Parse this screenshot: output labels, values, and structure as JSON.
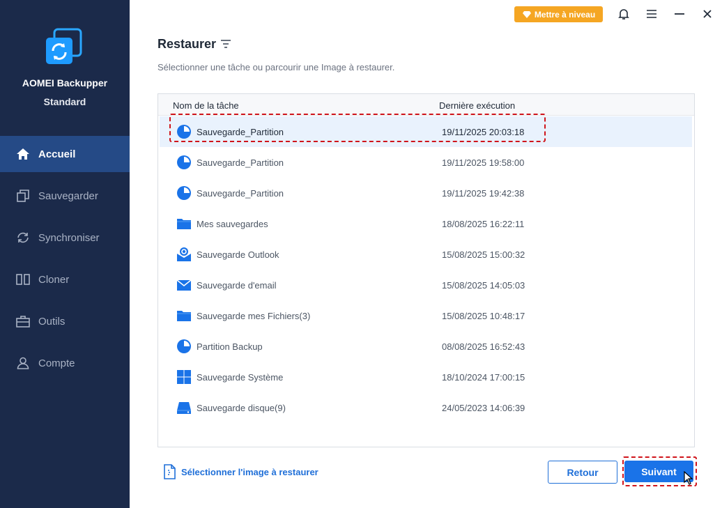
{
  "app": {
    "name": "AOMEI Backupper",
    "edition": "Standard"
  },
  "nav": [
    {
      "label": "Accueil",
      "icon": "home-icon",
      "active": true
    },
    {
      "label": "Sauvegarder",
      "icon": "copy-icon",
      "active": false
    },
    {
      "label": "Synchroniser",
      "icon": "sync-icon",
      "active": false
    },
    {
      "label": "Cloner",
      "icon": "clone-icon",
      "active": false
    },
    {
      "label": "Outils",
      "icon": "toolbox-icon",
      "active": false
    },
    {
      "label": "Compte",
      "icon": "user-icon",
      "active": false
    }
  ],
  "topbar": {
    "upgrade_label": "Mettre à niveau"
  },
  "page": {
    "title": "Restaurer",
    "subtitle": "Sélectionner une tâche ou parcourir une Image à restaurer."
  },
  "table": {
    "columns": [
      "Nom de la tâche",
      "Dernière exécution"
    ],
    "rows": [
      {
        "name": "Sauvegarde_Partition",
        "date": "19/11/2025 20:03:18",
        "icon": "partition-icon",
        "selected": true
      },
      {
        "name": "Sauvegarde_Partition",
        "date": "19/11/2025 19:58:00",
        "icon": "partition-icon"
      },
      {
        "name": "Sauvegarde_Partition",
        "date": "19/11/2025 19:42:38",
        "icon": "partition-icon"
      },
      {
        "name": "Mes sauvegardes",
        "date": "18/08/2025 16:22:11",
        "icon": "folder-icon"
      },
      {
        "name": "Sauvegarde Outlook",
        "date": "15/08/2025 15:00:32",
        "icon": "outlook-icon"
      },
      {
        "name": "Sauvegarde d'email",
        "date": "15/08/2025 14:05:03",
        "icon": "email-icon"
      },
      {
        "name": "Sauvegarde mes Fichiers(3)",
        "date": "15/08/2025 10:48:17",
        "icon": "folder-icon"
      },
      {
        "name": "Partition Backup",
        "date": "08/08/2025 16:52:43",
        "icon": "partition-icon"
      },
      {
        "name": "Sauvegarde Système",
        "date": "18/10/2024 17:00:15",
        "icon": "windows-icon"
      },
      {
        "name": "Sauvegarde disque(9)",
        "date": "24/05/2023 14:06:39",
        "icon": "disk-icon"
      }
    ]
  },
  "footer": {
    "select_image_label": "Sélectionner l'image à restaurer",
    "back_label": "Retour",
    "next_label": "Suivant"
  },
  "colors": {
    "sidebar": "#1b2a4a",
    "active_nav": "#254a86",
    "accent": "#1a73e8",
    "upgrade": "#f5a623",
    "highlight": "#d0141b"
  }
}
